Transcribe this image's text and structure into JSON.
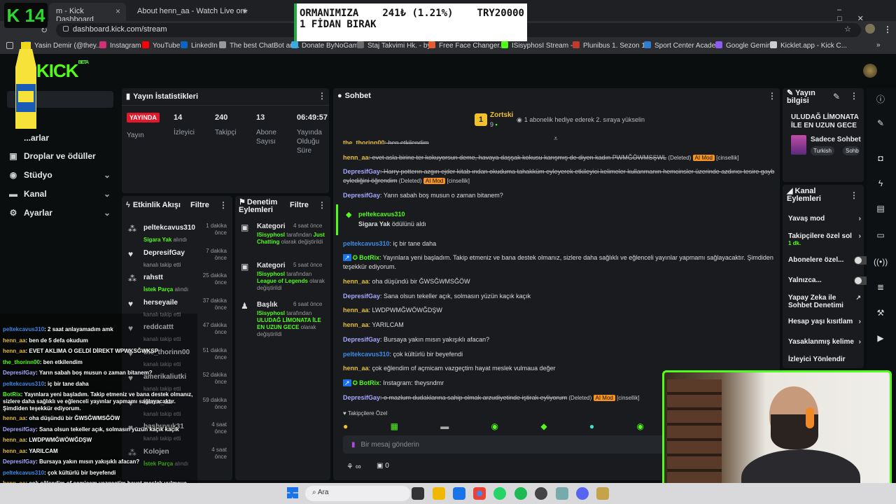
{
  "browser": {
    "tabs": [
      "m - Kick Dashboard",
      "About henn_aa - Watch Live on",
      "+"
    ],
    "url": "dashboard.kick.com/stream",
    "bookmarks": [
      "Yasin Demir (@they...",
      "Instagram",
      "YouTube",
      "LinkedIn",
      "The best ChatBot an...",
      "Donate ByNoGame",
      "Staj Takvimi Hk. - by...",
      "Free Face Changer...",
      "ISisyphosI Stream -...",
      "Plunibus 1. Sezon 1...",
      "Sport Center Acade...",
      "Google Gemini",
      "Kicklet.app - Kick C..."
    ]
  },
  "overlay": {
    "badge": "K 14",
    "donation": {
      "line1": "ORMANIMIZA",
      "amount": "241₺ (1.21%)",
      "goal": "TRY20000",
      "line2": "1 FİDAN BIRAK"
    }
  },
  "brand": {
    "logo": "KICK",
    "beta": "BETA"
  },
  "sidebar": {
    "items": [
      {
        "label": "...arlar",
        "icon": "settings-icon"
      },
      {
        "label": "Droplar ve ödüller",
        "icon": "gift-icon"
      },
      {
        "label": "Stüdyo",
        "icon": "studio-icon"
      },
      {
        "label": "Kanal",
        "icon": "channel-icon"
      },
      {
        "label": "Ayarlar",
        "icon": "gear-icon"
      }
    ]
  },
  "stats": {
    "title": "Yayın İstatistikleri",
    "live": "YAYINDA",
    "live_sub": "Yayın",
    "viewers": "14",
    "viewers_label": "İzleyici",
    "followers": "240",
    "followers_label": "Takipçi",
    "subs": "13",
    "subs_label": "Abone Sayısı",
    "duration": "06:49:57",
    "duration_label": "Yayında Olduğu Süre"
  },
  "activity": {
    "title": "Etkinlik Akışı",
    "filter": "Filtre",
    "items": [
      {
        "user": "peltekcavus310",
        "action": "Sigara Yak",
        "suffix": "alındı",
        "time": "1 dakika önce"
      },
      {
        "user": "DepresifGay",
        "action": "",
        "suffix": "kanalı takip etti",
        "time": "7 dakika önce"
      },
      {
        "user": "rahstt",
        "action": "İstek Parça",
        "suffix": "alındı",
        "time": "25 dakika önce"
      },
      {
        "user": "herseyaile",
        "action": "",
        "suffix": "kanalı takip etti",
        "time": "37 dakika önce"
      },
      {
        "user": "reddcattt",
        "action": "",
        "suffix": "kanalı takip etti",
        "time": "47 dakika önce"
      },
      {
        "user": "the_thorinn00",
        "action": "",
        "suffix": "kanalı takip etti",
        "time": "51 dakika önce"
      },
      {
        "user": "amerikaliutki",
        "action": "",
        "suffix": "kanalı takip etti",
        "time": "52 dakika önce"
      },
      {
        "user": "henn_aa",
        "action": "",
        "suffix": "kanalı takip etti",
        "time": "59 dakika önce"
      },
      {
        "user": "basbuyuk31",
        "action": "",
        "suffix": "kanalı takip etti",
        "time": "4 saat önce"
      },
      {
        "user": "Kolojen",
        "action": "İstek Parça",
        "suffix": "alındı",
        "time": "4 saat önce"
      }
    ]
  },
  "moderation": {
    "title": "Denetim Eylemleri",
    "filter": "Filtre",
    "items": [
      {
        "head": "Kategori",
        "time": "4 saat önce",
        "by": "ISisyphosI",
        "by_suffix": "tarafından",
        "value": "Just Chatting",
        "tail": "olarak değiştirildi"
      },
      {
        "head": "Kategori",
        "time": "5 saat önce",
        "by": "ISisyphosI",
        "by_suffix": "tarafından",
        "value": "League of Legends",
        "tail": "olarak değiştirildi"
      },
      {
        "head": "Başlık",
        "time": "6 saat önce",
        "by": "ISisyphosI",
        "by_suffix": "tarafından",
        "value": "ULUDAĞ LİMONATA İLE EN UZUN GECE",
        "tail": "olarak değiştirildi"
      }
    ]
  },
  "chat": {
    "title": "Sohbet",
    "pinned_user": "Zortski",
    "pinned_count": "9",
    "pinned_msg": "1 abonelik hediye ederek 2. sıraya yükselin",
    "reward_user": "peltekcavus310",
    "reward_text": "Sigara Yak",
    "reward_suffix": "ödülünü aldı",
    "followers_only": "Takipçilere Özel",
    "input_placeholder": "Bir mesaj gönderin",
    "counter": "0",
    "messages": [
      {
        "user": "the_thorinn00",
        "cls": "u-henn",
        "text": ": ben etkilendim",
        "strike": true,
        "tags": ""
      },
      {
        "user": "henn_aa",
        "cls": "u-henn",
        "text": ": evet asla birine ter kokuyorsun deme, havaya daşşak kokusu karışmış de diyen kadın PWMĞÖWMSŞWL",
        "strike": true,
        "tags": "(Deleted) |AI Mod| [cinsellik]"
      },
      {
        "user": "DepresifGay",
        "cls": "u-dep",
        "text": ": Harry potterın azgın ejder kitab ından okuduma tahakküm eyleyerek etkileyici kelimeler kullanmanın hemcinsler üzerinde azdırıcı tesire gayb eylediğini öğrendim",
        "strike": true,
        "tags": "(Deleted) |AI Mod| [cinsellik]"
      },
      {
        "user": "DepresifGay",
        "cls": "u-dep",
        "text": ": Yarın sabah boş musun o zaman bitanem?",
        "strike": false,
        "tags": ""
      }
    ],
    "messages2": [
      {
        "user": "peltekcavus310",
        "cls": "u-pelt",
        "text": ": iç bir tane daha"
      },
      {
        "user": "BotRix",
        "cls": "u-bot",
        "text": ": Yayınlara yeni başladım. Takip etmeniz ve bana destek olmanız, sizlere daha sağlıklı ve eğlenceli yayınlar yapmamı sağlayacaktır. Şimdiden teşekkür ediyorum."
      },
      {
        "user": "henn_aa",
        "cls": "u-henn",
        "text": ": oha düşündü bir ĞWSĞWMSĞÖW"
      },
      {
        "user": "DepresifGay",
        "cls": "u-dep",
        "text": ": Sana olsun tekeller açık, solmasın yüzün kaçık kaçık"
      },
      {
        "user": "henn_aa",
        "cls": "u-henn",
        "text": ": LWDPWMĞWÖWĞDŞW"
      },
      {
        "user": "henn_aa",
        "cls": "u-henn",
        "text": ": YARILCAM"
      },
      {
        "user": "DepresifGay",
        "cls": "u-dep",
        "text": ": Bursaya yakın mısın yakışıklı afacan?"
      },
      {
        "user": "peltekcavus310",
        "cls": "u-pelt",
        "text": ": çok kültürlü bir beyefendi"
      },
      {
        "user": "henn_aa",
        "cls": "u-henn",
        "text": ": çok eğlendim of açmicam vazgeçtim hayat meslek vulmaua değer"
      },
      {
        "user": "BotRix",
        "cls": "u-bot",
        "text": ": Instagram: theysndmr"
      }
    ],
    "last": {
      "user": "DepresifGay",
      "text": ": o mazlum dudaklarına sahip olmak arzudiyetinde iştirak eyliyorum",
      "tags": "(Deleted) |AI Mod| [cinsellik]"
    }
  },
  "streaminfo": {
    "title": "Yayın bilgisi",
    "stream_title": "ULUDAĞ LİMONATA İLE EN UZUN GECE",
    "category": "Sadece Sohbet",
    "tags": [
      "Turkish",
      "Sohb"
    ]
  },
  "channel_actions": {
    "title": "Kanal Eylemleri",
    "items": [
      {
        "label": "Yavaş mod",
        "type": "arrow"
      },
      {
        "label": "Takipçilere özel sol",
        "sub": "1 dk.",
        "type": "arrow"
      },
      {
        "label": "Abonelere özel...",
        "type": "toggle"
      },
      {
        "label": "Yalnızca...",
        "type": "toggle"
      },
      {
        "label": "Yapay Zeka ile Sohbet Denetimi",
        "type": "link"
      },
      {
        "label": "Hesap yaşı kısıtlam",
        "type": "arrow"
      },
      {
        "label": "Yasaklanmış kelime",
        "type": "arrow"
      },
      {
        "label": "İzleyici Yönlendir",
        "type": "none"
      }
    ]
  },
  "overlay_chat": [
    {
      "user": "peltekcavus310",
      "cls": "u-pelt",
      "text": ": 2 saat anlayamadım amk"
    },
    {
      "user": "henn_aa",
      "cls": "u-henn",
      "text": ": ben de 5 defa okudum"
    },
    {
      "user": "henn_aa",
      "cls": "u-henn",
      "text": ": EVET AKLIMA O GELDİ DİREKT WPWKSĞWKSP"
    },
    {
      "user": "the_thorinn00",
      "cls": "u-bot",
      "text": ": ben etkilendim"
    },
    {
      "user": "DepresifGay",
      "cls": "u-dep",
      "text": ": Yarın sabah boş musun o zaman bitanem?"
    },
    {
      "user": "peltekcavus310",
      "cls": "u-pelt",
      "text": ": iç bir tane daha"
    },
    {
      "user": "BotRix",
      "cls": "u-bot",
      "text": ": Yayınlara yeni başladım. Takip etmeniz ve bana destek olmanız, sizlere daha sağlıklı ve eğlenceli yayınlar yapmamı sağlayacaktır. Şimdiden teşekkür ediyorum."
    },
    {
      "user": "henn_aa",
      "cls": "u-henn",
      "text": ": oha düşündü bir ĞWSĞWMSĞÖW"
    },
    {
      "user": "DepresifGay",
      "cls": "u-dep",
      "text": ": Sana olsun tekeller açık, solmasın yüzün kaçık kaçık"
    },
    {
      "user": "henn_aa",
      "cls": "u-henn",
      "text": ": LWDPWMĞWÖWĞDŞW"
    },
    {
      "user": "henn_aa",
      "cls": "u-henn",
      "text": ": YARILCAM"
    },
    {
      "user": "DepresifGay",
      "cls": "u-dep",
      "text": ": Bursaya yakın mısın yakışıklı afacan?"
    },
    {
      "user": "peltekcavus310",
      "cls": "u-pelt",
      "text": ": çok kültürlü bir beyefendi"
    },
    {
      "user": "henn_aa",
      "cls": "u-henn",
      "text": ": çok eğlendim of açmicam vazgeçtim hayat meslek vulmaua değer"
    },
    {
      "user": "BotRix",
      "cls": "u-bot",
      "text": ": Instagram: theysndmr"
    }
  ],
  "taskbar": {
    "search": "Ara"
  },
  "colors": {
    "kick_green": "#53fc18",
    "live_red": "#e1172a",
    "ai_mod": "#f7931e"
  }
}
